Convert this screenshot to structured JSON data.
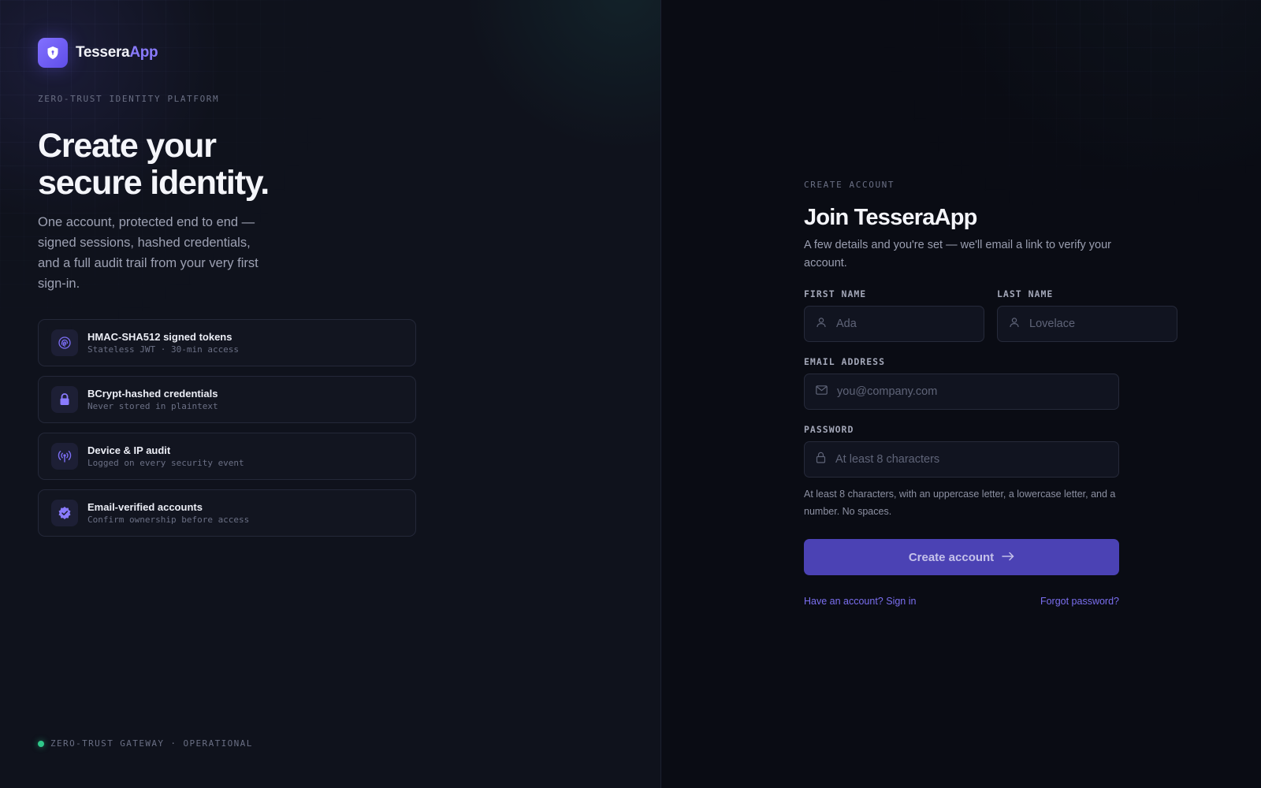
{
  "brand": {
    "name_primary": "Tessera",
    "name_accent": "App",
    "logo_icon": "shield-icon"
  },
  "left": {
    "eyebrow": "ZERO-TRUST IDENTITY PLATFORM",
    "hero_line1": "Create your",
    "hero_line2": "secure identity.",
    "hero_sub": "One account, protected end to end — signed sessions, hashed credentials, and a full audit trail from your very first sign-in.",
    "features": [
      {
        "icon": "fingerprint-icon",
        "title": "HMAC-SHA512 signed tokens",
        "desc": "Stateless JWT · 30-min access"
      },
      {
        "icon": "lock-icon",
        "title": "BCrypt-hashed credentials",
        "desc": "Never stored in plaintext"
      },
      {
        "icon": "broadcast-icon",
        "title": "Device & IP audit",
        "desc": "Logged on every security event"
      },
      {
        "icon": "verified-badge-icon",
        "title": "Email-verified accounts",
        "desc": "Confirm ownership before access"
      }
    ],
    "status": "ZERO-TRUST GATEWAY · OPERATIONAL"
  },
  "form": {
    "eyebrow": "CREATE ACCOUNT",
    "title": "Join TesseraApp",
    "subtitle": "A few details and you're set — we'll email a link to verify your account.",
    "first_name": {
      "label": "FIRST NAME",
      "placeholder": "Ada",
      "value": ""
    },
    "last_name": {
      "label": "LAST NAME",
      "placeholder": "Lovelace",
      "value": ""
    },
    "email": {
      "label": "EMAIL ADDRESS",
      "placeholder": "you@company.com",
      "value": ""
    },
    "password": {
      "label": "PASSWORD",
      "placeholder": "At least 8 characters",
      "value": ""
    },
    "password_hint": "At least 8 characters, with an uppercase letter, a lowercase letter, and a number. No spaces.",
    "submit_label": "Create account",
    "signin_link": "Have an account? Sign in",
    "forgot_link": "Forgot password?"
  },
  "colors": {
    "accent": "#8a7bff",
    "button": "#4b42b4",
    "status_ok": "#2fc88a",
    "background": "#0a0c14"
  }
}
